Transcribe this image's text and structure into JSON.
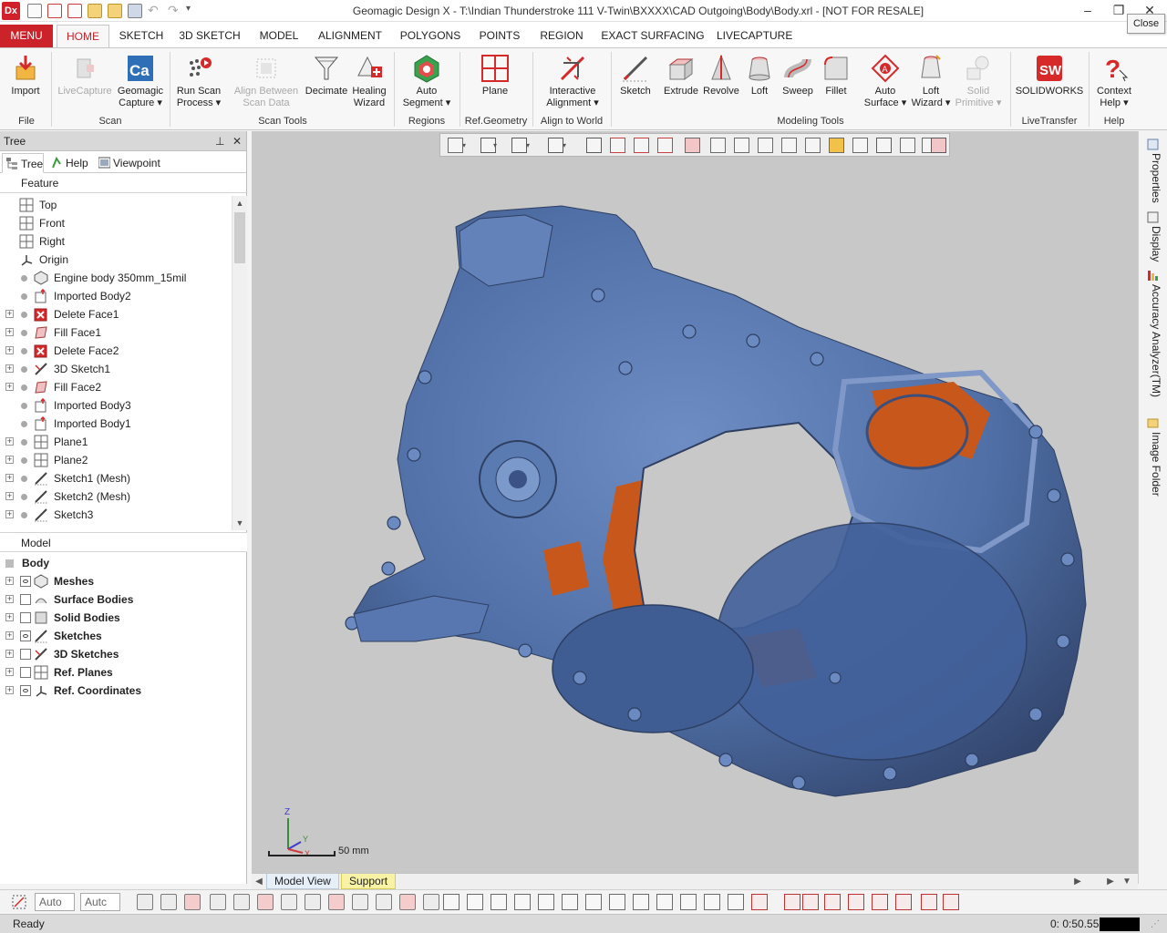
{
  "app": {
    "logo": "Dx",
    "title": "Geomagic Design X - T:\\Indian Thunderstroke 111 V-Twin\\BXXXX\\CAD Outgoing\\Body\\Body.xrl - [NOT FOR RESALE]",
    "close_tooltip": "Close"
  },
  "ribbon_tabs": {
    "menu": "MENU",
    "items": [
      "HOME",
      "SKETCH",
      "3D SKETCH",
      "MODEL",
      "ALIGNMENT",
      "POLYGONS",
      "POINTS",
      "REGION",
      "EXACT SURFACING",
      "LIVECAPTURE"
    ],
    "active": "HOME"
  },
  "ribbon": {
    "buttons": [
      {
        "label": "Import",
        "icon": "import-icon",
        "enabled": true
      },
      {
        "label": "LiveCapture",
        "icon": "livecapture-icon",
        "enabled": false
      },
      {
        "label": "Geomagic\nCapture ▾",
        "icon": "capture-icon",
        "enabled": true
      },
      {
        "label": "Run Scan\nProcess ▾",
        "icon": "run-scan-icon",
        "enabled": true
      },
      {
        "label": "Align Between\nScan Data",
        "icon": "align-scan-icon",
        "enabled": false
      },
      {
        "label": "Decimate",
        "icon": "decimate-icon",
        "enabled": true
      },
      {
        "label": "Healing\nWizard",
        "icon": "healing-icon",
        "enabled": true
      },
      {
        "label": "Auto\nSegment ▾",
        "icon": "auto-segment-icon",
        "enabled": true
      },
      {
        "label": "Plane",
        "icon": "plane-icon",
        "enabled": true
      },
      {
        "label": "Interactive\nAlignment ▾",
        "icon": "interactive-alignment-icon",
        "enabled": true
      },
      {
        "label": "Sketch",
        "icon": "sketch-icon",
        "enabled": true
      },
      {
        "label": "Extrude",
        "icon": "extrude-icon",
        "enabled": true
      },
      {
        "label": "Revolve",
        "icon": "revolve-icon",
        "enabled": true
      },
      {
        "label": "Loft",
        "icon": "loft-icon",
        "enabled": true
      },
      {
        "label": "Sweep",
        "icon": "sweep-icon",
        "enabled": true
      },
      {
        "label": "Fillet",
        "icon": "fillet-icon",
        "enabled": true
      },
      {
        "label": "Auto\nSurface ▾",
        "icon": "auto-surface-icon",
        "enabled": true
      },
      {
        "label": "Loft\nWizard ▾",
        "icon": "loft-wizard-icon",
        "enabled": true
      },
      {
        "label": "Solid\nPrimitive ▾",
        "icon": "solid-primitive-icon",
        "enabled": false
      },
      {
        "label": "SOLIDWORKS",
        "icon": "solidworks-icon",
        "enabled": true
      },
      {
        "label": "Context\nHelp ▾",
        "icon": "context-help-icon",
        "enabled": true
      }
    ],
    "groups": [
      "File",
      "Scan",
      "Scan Tools",
      "Regions",
      "Ref.Geometry",
      "Align to World",
      "Modeling Tools",
      "LiveTransfer",
      "Help"
    ]
  },
  "tree_panel": {
    "title": "Tree",
    "tabs": [
      "Tree",
      "Help",
      "Viewpoint"
    ],
    "feature_header": "Feature",
    "features": [
      {
        "label": "Top",
        "icon": "plane-icon",
        "expand": false,
        "dot": false
      },
      {
        "label": "Front",
        "icon": "plane-icon",
        "expand": false,
        "dot": false
      },
      {
        "label": "Right",
        "icon": "plane-icon",
        "expand": false,
        "dot": false
      },
      {
        "label": "Origin",
        "icon": "origin-icon",
        "expand": false,
        "dot": false
      },
      {
        "label": "Engine body 350mm_15mil",
        "icon": "mesh-icon",
        "expand": false,
        "dot": true
      },
      {
        "label": "Imported Body2",
        "icon": "imported-body-icon",
        "expand": false,
        "dot": true
      },
      {
        "label": "Delete Face1",
        "icon": "delete-face-icon",
        "expand": true,
        "dot": true
      },
      {
        "label": "Fill Face1",
        "icon": "fill-face-icon",
        "expand": true,
        "dot": true
      },
      {
        "label": "Delete Face2",
        "icon": "delete-face-icon",
        "expand": true,
        "dot": true
      },
      {
        "label": "3D Sketch1",
        "icon": "3d-sketch-icon",
        "expand": true,
        "dot": true
      },
      {
        "label": "Fill Face2",
        "icon": "fill-face-icon",
        "expand": true,
        "dot": true
      },
      {
        "label": "Imported Body3",
        "icon": "imported-body-icon",
        "expand": false,
        "dot": true
      },
      {
        "label": "Imported Body1",
        "icon": "imported-body-icon",
        "expand": false,
        "dot": true
      },
      {
        "label": "Plane1",
        "icon": "plane-icon",
        "expand": true,
        "dot": true
      },
      {
        "label": "Plane2",
        "icon": "plane-icon",
        "expand": true,
        "dot": true
      },
      {
        "label": "Sketch1 (Mesh)",
        "icon": "sketch-icon",
        "expand": true,
        "dot": true
      },
      {
        "label": "Sketch2 (Mesh)",
        "icon": "sketch-icon",
        "expand": true,
        "dot": true
      },
      {
        "label": "Sketch3",
        "icon": "sketch-icon",
        "expand": true,
        "dot": true
      }
    ],
    "model_header": "Model",
    "model_root": "Body",
    "model_items": [
      {
        "label": "Meshes",
        "icon": "mesh-icon",
        "check": "eye"
      },
      {
        "label": "Surface Bodies",
        "icon": "surface-body-icon",
        "check": "box"
      },
      {
        "label": "Solid Bodies",
        "icon": "solid-body-icon",
        "check": "box"
      },
      {
        "label": "Sketches",
        "icon": "sketch-icon",
        "check": "eye"
      },
      {
        "label": "3D Sketches",
        "icon": "3d-sketch-icon",
        "check": "box"
      },
      {
        "label": "Ref. Planes",
        "icon": "plane-icon",
        "check": "box"
      },
      {
        "label": "Ref. Coordinates",
        "icon": "origin-icon",
        "check": "eye"
      }
    ]
  },
  "viewport": {
    "scale_label": "50 mm",
    "triad": {
      "z": "Z",
      "y": "Y",
      "x": "X"
    },
    "colors": {
      "background": "#c8c8c8",
      "mesh": "#4f6fa6",
      "interior": "#c8571c"
    }
  },
  "side_panel": {
    "tabs": [
      "Properties",
      "Display",
      "Accuracy Analyzer(TM)",
      "Image Folder"
    ]
  },
  "view_tabs": [
    "Model View",
    "Support"
  ],
  "bottom_toolbar": {
    "select1": "Auto",
    "select2": "Autc"
  },
  "status": {
    "text": "Ready",
    "timer": "0: 0:50.55"
  },
  "colors": {
    "accent": "#cc2229"
  }
}
